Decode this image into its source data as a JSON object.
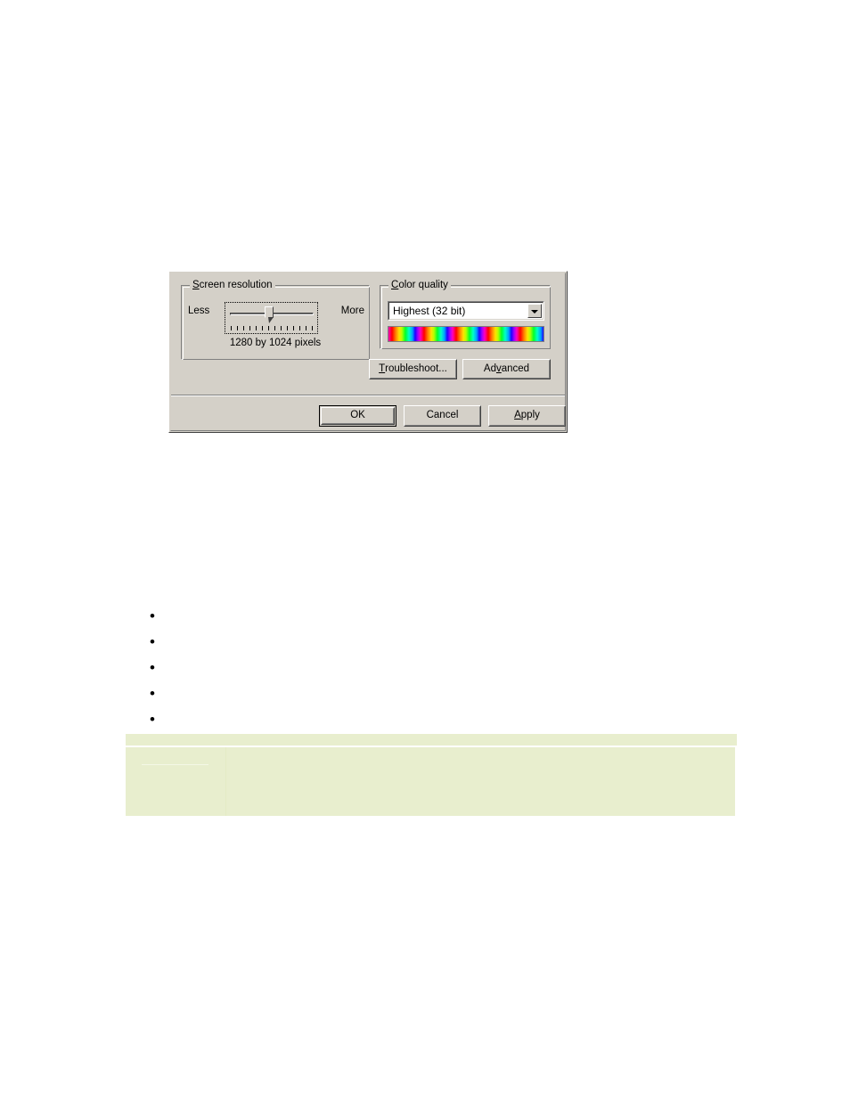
{
  "dialog": {
    "name": "display-properties-settings",
    "background_color": "#d4d0c8",
    "screen_resolution": {
      "legend": "Screen resolution",
      "legend_accesskey": "S",
      "less_label": "Less",
      "more_label": "More",
      "value_caption": "1280 by 1024 pixels",
      "slider": {
        "name": "resolution-slider",
        "position_percent": 46,
        "tick_count": 14
      }
    },
    "color_quality": {
      "legend": "Color quality",
      "legend_accesskey": "C",
      "selected_option": "Highest (32 bit)",
      "options": [
        "Highest (32 bit)"
      ],
      "spectrum_preview_name": "color-spectrum-preview"
    },
    "buttons": {
      "troubleshoot": {
        "label": "Troubleshoot...",
        "accesskey": "T"
      },
      "advanced": {
        "label": "Advanced",
        "accesskey": "v"
      },
      "ok": {
        "label": "OK",
        "default": true
      },
      "cancel": {
        "label": "Cancel"
      },
      "apply": {
        "label": "Apply",
        "accesskey": "A"
      }
    }
  },
  "document": {
    "bullet_list": [
      {
        "text": ""
      },
      {
        "text": ""
      },
      {
        "text": ""
      },
      {
        "text": ""
      },
      {
        "text": ""
      }
    ],
    "note_box": {
      "header_text": "",
      "body_text": "",
      "background_color": "#e8eece"
    }
  }
}
